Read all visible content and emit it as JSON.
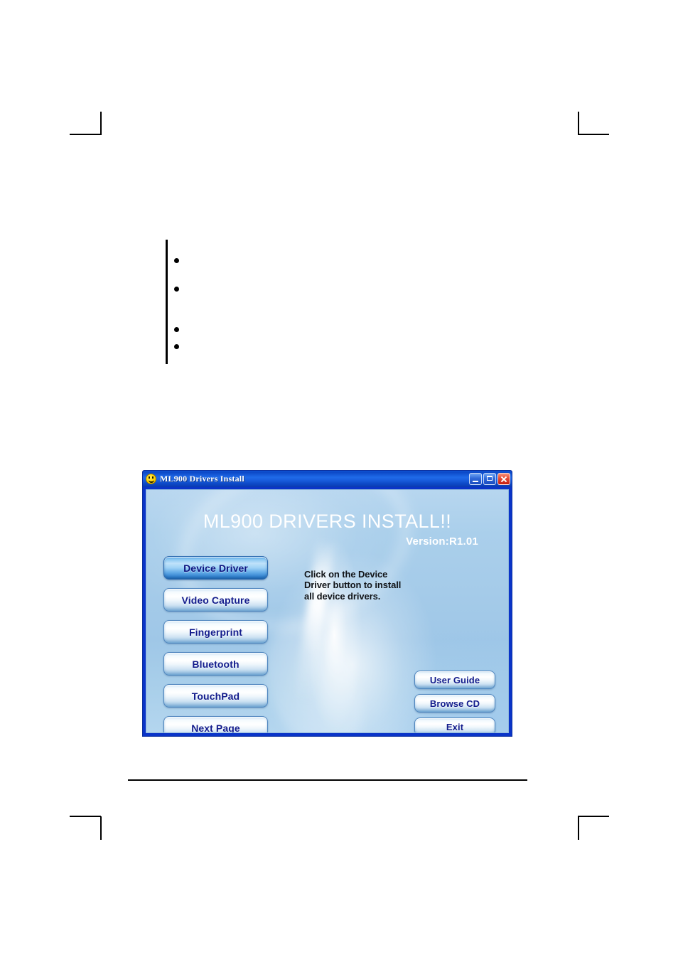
{
  "document": {
    "crop_marks": [
      "top-left",
      "top-right",
      "bottom-left",
      "bottom-right"
    ],
    "bullets": [
      {
        "text": ""
      },
      {
        "text": ""
      },
      {
        "text": ""
      },
      {
        "text": ""
      }
    ]
  },
  "window": {
    "titlebar": {
      "icon": "smiley-face-icon",
      "title": "ML900 Drivers Install",
      "minimize_label": "",
      "maximize_label": "",
      "close_label": ""
    },
    "heading": "ML900 DRIVERS INSTALL!!",
    "version": "Version:R1.01",
    "instruction": "Click on the Device\nDriver button to install\nall device  drivers.",
    "left_buttons": [
      {
        "label": "Device Driver",
        "active": true
      },
      {
        "label": "Video Capture",
        "active": false
      },
      {
        "label": "Fingerprint",
        "active": false
      },
      {
        "label": "Bluetooth",
        "active": false
      },
      {
        "label": "TouchPad",
        "active": false
      },
      {
        "label": "Next Page",
        "active": false
      }
    ],
    "right_buttons": [
      {
        "label": "User Guide"
      },
      {
        "label": "Browse CD"
      },
      {
        "label": "Exit"
      }
    ],
    "colors": {
      "titlebar_blue": "#1a5fe0",
      "close_red": "#c41f12",
      "frame_blue": "#0a34c8",
      "body_blue": "#a5cbe9",
      "button_text_navy": "#131c8c",
      "heading_white": "#ffffff"
    }
  }
}
